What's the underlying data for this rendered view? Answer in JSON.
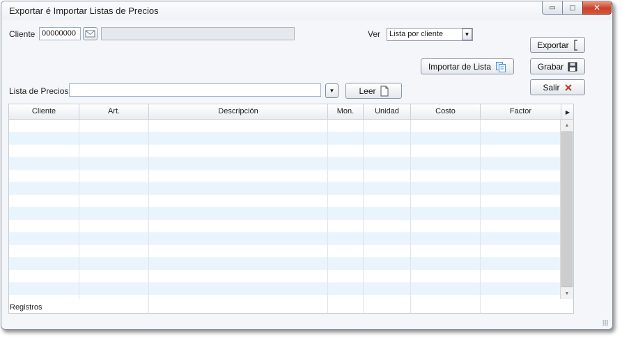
{
  "window": {
    "title": "Exportar é Importar Listas de Precios",
    "controls": {
      "minimize": "▭",
      "maximize": "▢",
      "close": "✕"
    }
  },
  "filters": {
    "cliente_label": "Cliente",
    "cliente_code": "00000000",
    "cliente_name": "",
    "ver_label": "Ver",
    "ver_selected": "Lista por cliente",
    "lista_label": "Lista de Precios",
    "lista_value": ""
  },
  "buttons": {
    "exportar": "Exportar",
    "importar": "Importar de Lista",
    "grabar": "Grabar",
    "salir": "Salir",
    "leer": "Leer"
  },
  "icons": {
    "cliente_lookup": "envelope-icon",
    "exportar": "bracket-icon",
    "importar": "copy-pages-icon",
    "grabar": "floppy-icon",
    "salir": "close-x-icon",
    "leer": "document-icon"
  },
  "colors": {
    "accent_close": "#c8422a",
    "row_alt": "#eaf4fc",
    "salir_icon": "#c0392b",
    "importar_icon": "#4a8fd8"
  },
  "table": {
    "columns": [
      "Cliente",
      "Art.",
      "Descripción",
      "Mon.",
      "Unidad",
      "Costo",
      "Factor"
    ],
    "rows": [],
    "footer_label": "Registros"
  }
}
